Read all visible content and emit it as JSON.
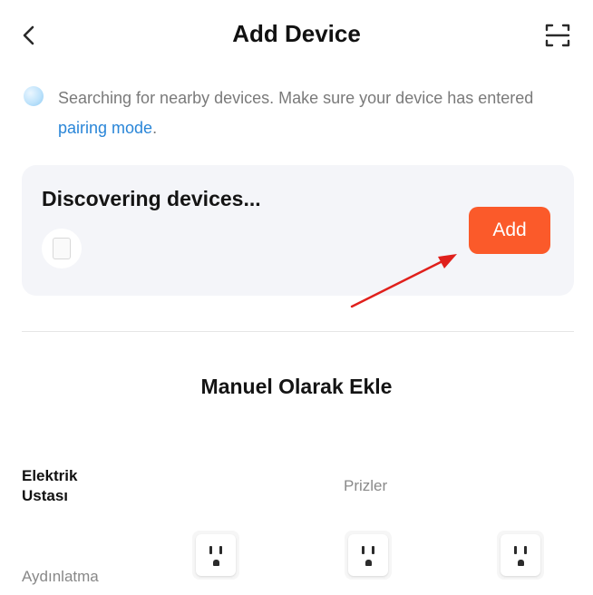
{
  "header": {
    "title": "Add Device",
    "back_icon": "chevron-left-icon",
    "scan_icon": "scan-icon"
  },
  "notice": {
    "text": "Searching for nearby devices. Make sure your device has entered ",
    "link": "pairing mode",
    "suffix": "."
  },
  "discovery": {
    "title": "Discovering devices...",
    "add_label": "Add"
  },
  "manual": {
    "title": "Manuel Olarak Ekle",
    "categories": [
      {
        "label": "Elektrik\nUstası",
        "selected": true
      },
      {
        "label": "Aydınlatma",
        "selected": false
      }
    ],
    "subcategory": "Prizler"
  },
  "colors": {
    "accent": "#fb5a2a",
    "link": "#2a86d8",
    "card_bg": "#f4f5f9",
    "arrow": "#e0201c"
  }
}
